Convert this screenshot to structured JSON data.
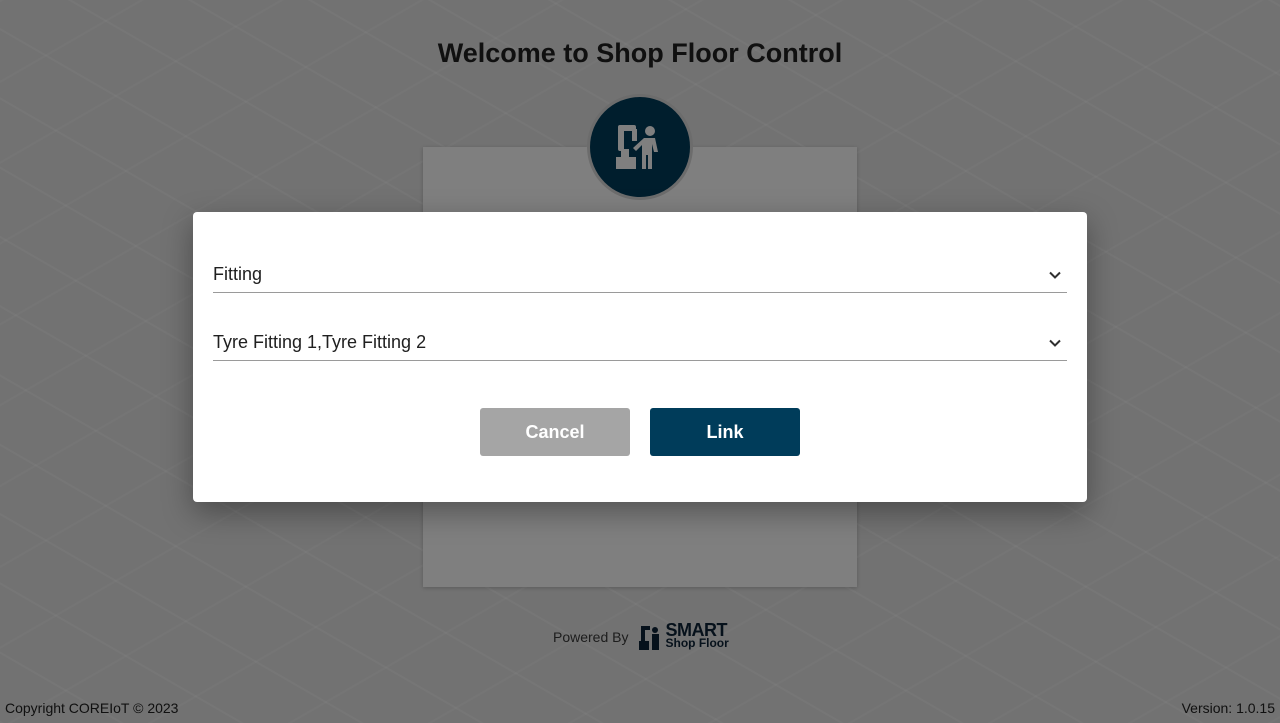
{
  "page": {
    "title": "Welcome to Shop Floor Control"
  },
  "footer": {
    "powered_by": "Powered By",
    "brand_line1": "SMART",
    "brand_line2": "Shop Floor",
    "copyright": "Copyright COREIoT © 2023",
    "version": "Version: 1.0.15"
  },
  "dialog": {
    "area_select": {
      "value": "Fitting"
    },
    "station_select": {
      "value": "Tyre Fitting 1,Tyre Fitting 2"
    },
    "cancel_label": "Cancel",
    "link_label": "Link"
  },
  "colors": {
    "primary": "#003c5a",
    "cancel_gray": "#a5a5a5",
    "overlay": "rgba(0,0,0,0.5)"
  },
  "icons": {
    "logo": "robot-arm-worker-icon",
    "chevron": "chevron-down-icon"
  }
}
